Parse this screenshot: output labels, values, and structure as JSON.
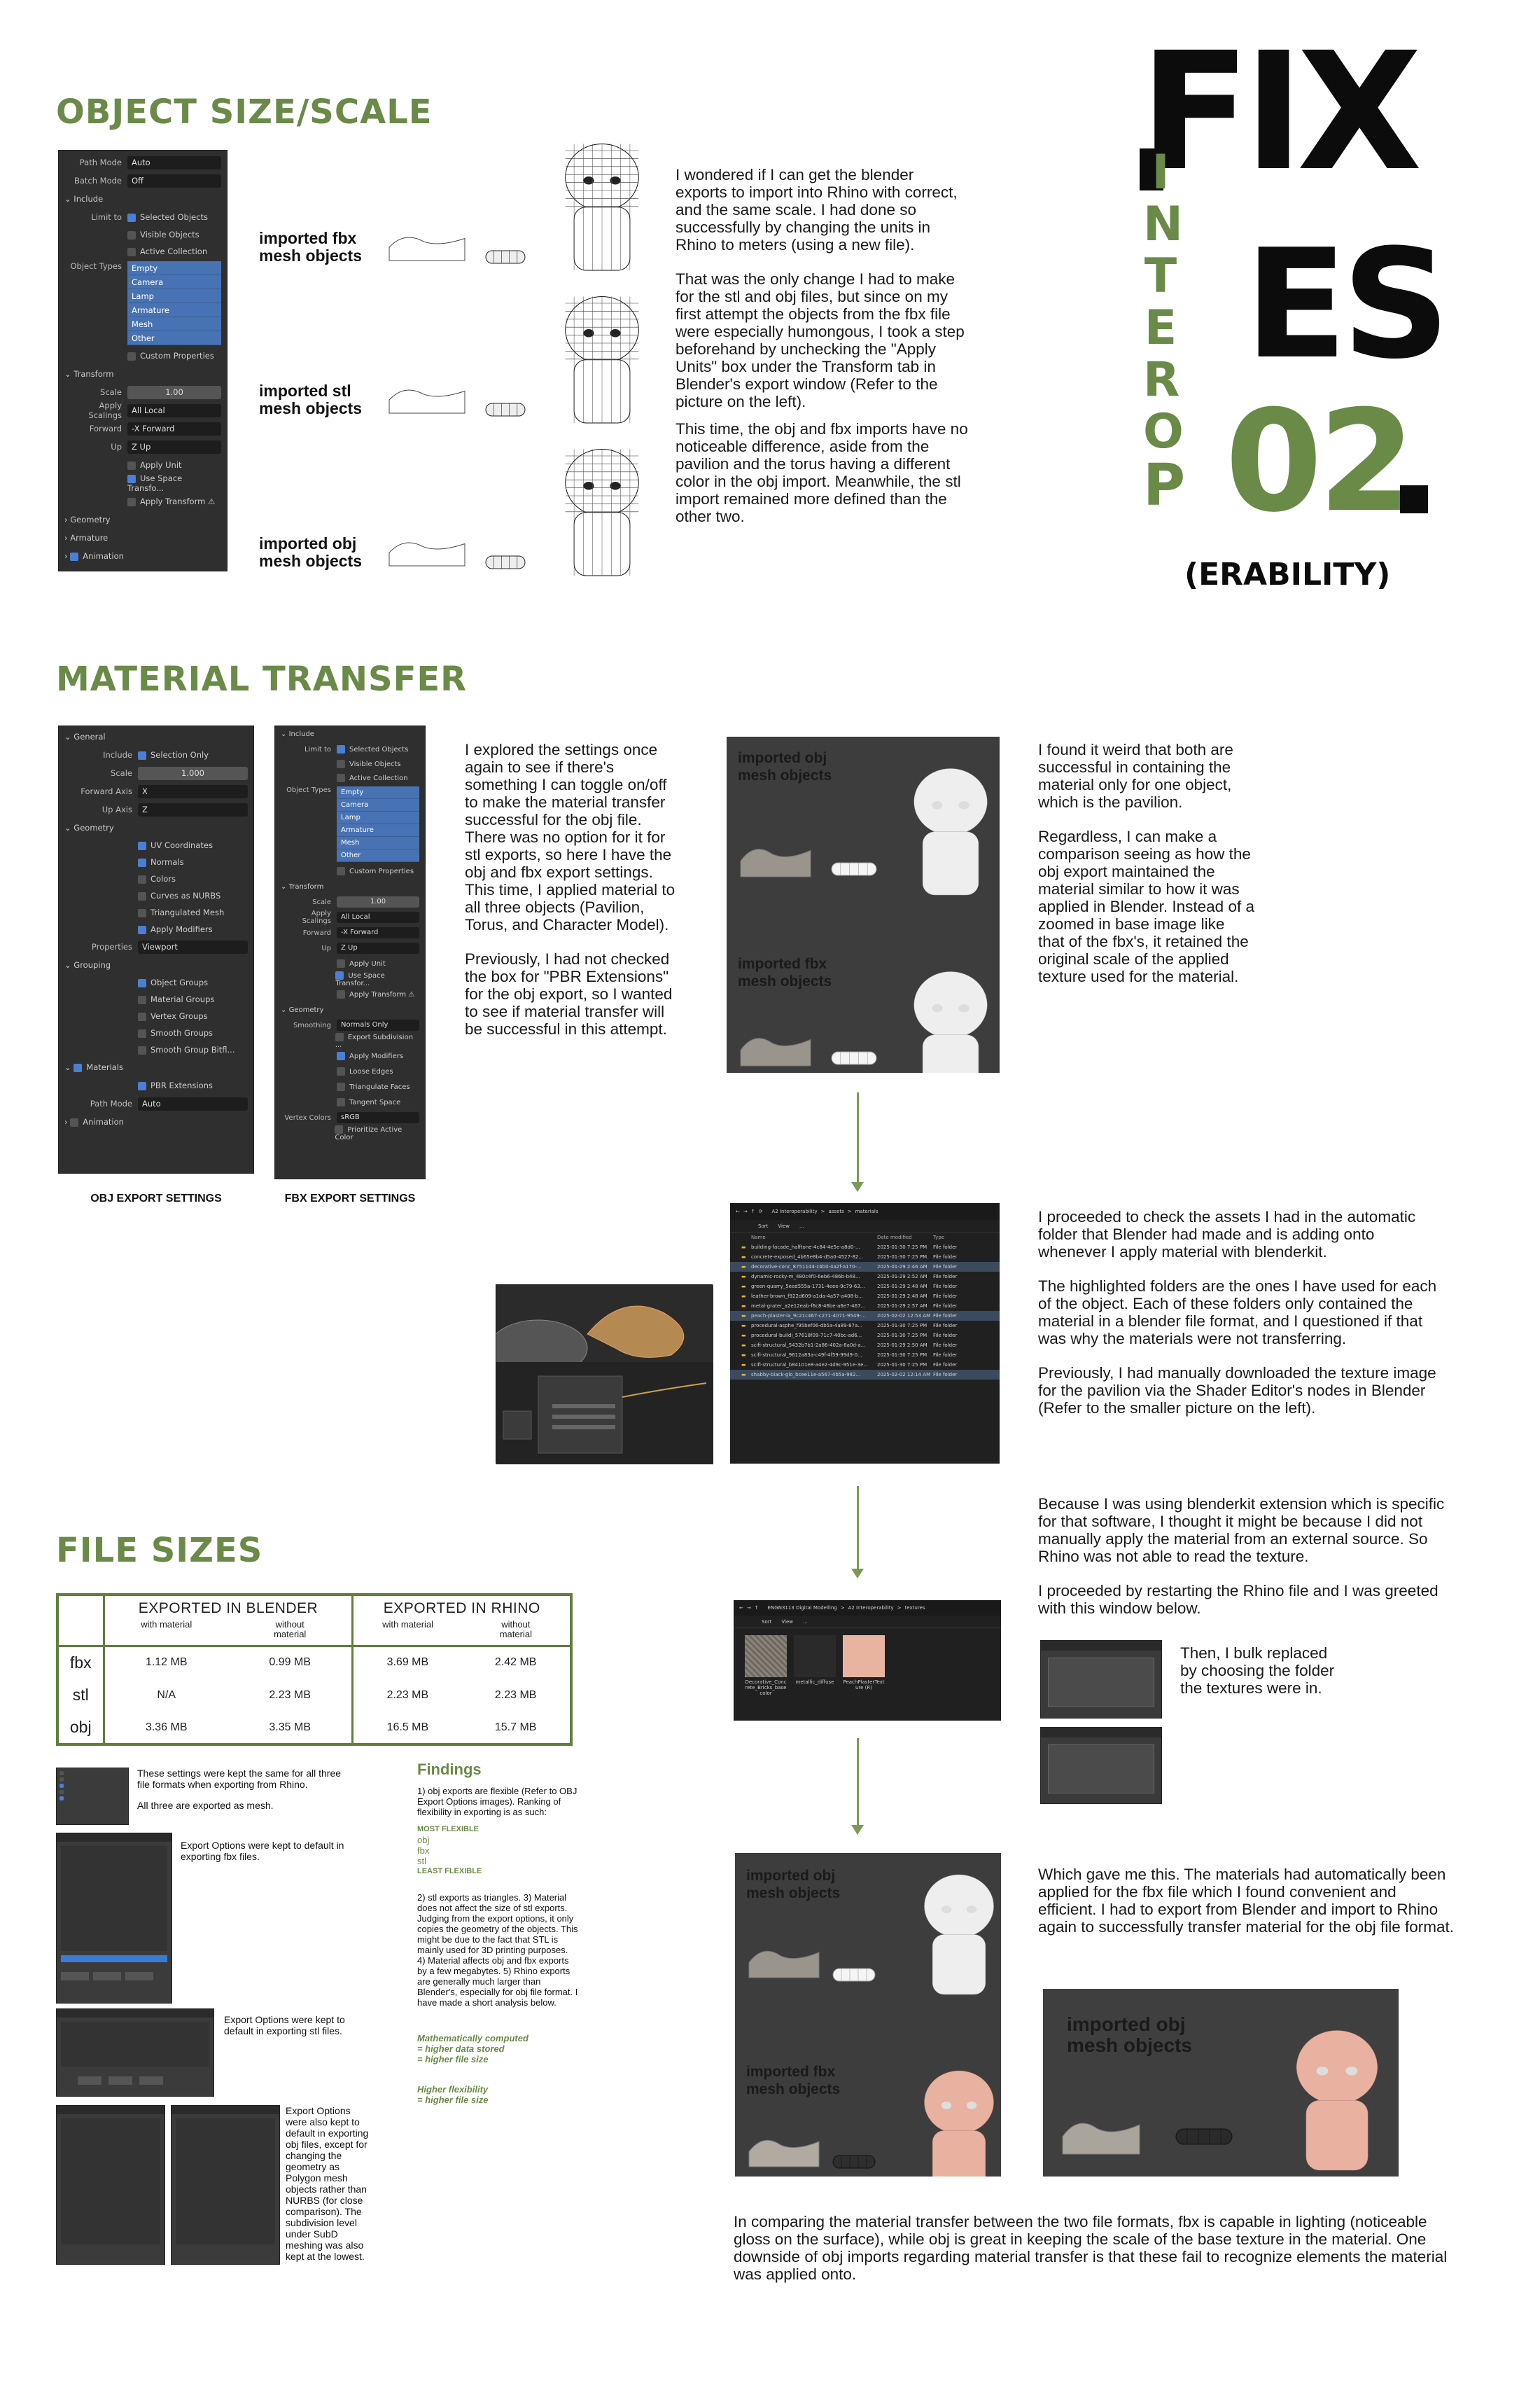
{
  "title": {
    "fix1": "FIX",
    "fix2": "ES",
    "num": "02",
    "dot": ".",
    "interop_letters": [
      "I",
      "N",
      "T",
      "E",
      "R",
      "O",
      "P"
    ],
    "erability": "(ERABILITY)"
  },
  "section1": {
    "heading": "OBJECT SIZE/SCALE",
    "panel": {
      "rows": [
        {
          "k": "Path Mode",
          "v": "Auto"
        },
        {
          "k": "Batch Mode",
          "v": "Off"
        }
      ],
      "include": "Include",
      "limit_to": "Limit to",
      "selected_objects": "Selected Objects",
      "visible_objects": "Visible Objects",
      "active_collection": "Active Collection",
      "object_types": "Object Types",
      "types": [
        "Empty",
        "Camera",
        "Lamp",
        "Armature",
        "Mesh",
        "Other"
      ],
      "custom_properties": "Custom Properties",
      "transform": "Transform",
      "scale_k": "Scale",
      "scale_v": "1.00",
      "apply_scalings_k": "Apply Scalings",
      "apply_scalings_v": "All Local",
      "forward_k": "Forward",
      "forward_v": "-X Forward",
      "up_k": "Up",
      "up_v": "Z Up",
      "apply_unit": "Apply Unit",
      "use_space": "Use Space Transfo...",
      "apply_transform": "Apply Transform",
      "geometry": "Geometry",
      "armature": "Armature",
      "animation": "Animation"
    },
    "labels": [
      "imported fbx mesh objects",
      "imported stl mesh objects",
      "imported obj mesh objects"
    ],
    "text": [
      "I wondered if I can get the blender exports to import into Rhino with correct, and the same scale. I had done so successfully by changing the units in Rhino to meters (using a new file).",
      "That was the only change I had to make for the stl and obj files, but since on my first attempt the objects from the fbx file were especially humongous, I took a step beforehand by unchecking the \"Apply Units\" box under the Transform tab in Blender's export window (Refer to the picture on the left).",
      "This time, the obj and fbx imports have no noticeable difference, aside from the pavilion and the torus having a different color in the obj import. Meanwhile, the stl import remained more defined than the other two."
    ]
  },
  "section2": {
    "heading": "MATERIAL TRANSFER",
    "obj_panel": {
      "general": "General",
      "include_k": "Include",
      "include_v": "Selection Only",
      "scale_k": "Scale",
      "scale_v": "1.000",
      "forward_k": "Forward Axis",
      "forward_v": "X",
      "up_k": "Up Axis",
      "up_v": "Z",
      "geometry": "Geometry",
      "geo_items": [
        "UV Coordinates",
        "Normals",
        "Colors",
        "Curves as NURBS",
        "Triangulated Mesh",
        "Apply Modifiers"
      ],
      "properties_k": "Properties",
      "properties_v": "Viewport",
      "grouping": "Grouping",
      "group_items": [
        "Object Groups",
        "Material Groups",
        "Vertex Groups",
        "Smooth Groups",
        "Smooth Group Bitfl..."
      ],
      "materials": "Materials",
      "pbr": "PBR Extensions",
      "path_k": "Path Mode",
      "path_v": "Auto",
      "animation": "Animation"
    },
    "fbx_panel": {
      "include": "Include",
      "limit_to": "Limit to",
      "selected_objects": "Selected Objects",
      "visible_objects": "Visible Objects",
      "active_collection": "Active Collection",
      "object_types": "Object Types",
      "types": [
        "Empty",
        "Camera",
        "Lamp",
        "Armature",
        "Mesh",
        "Other"
      ],
      "custom_properties": "Custom Properties",
      "transform": "Transform",
      "scale_k": "Scale",
      "scale_v": "1.00",
      "apply_scalings_k": "Apply Scalings",
      "apply_scalings_v": "All Local",
      "forward_k": "Forward",
      "forward_v": "-X Forward",
      "up_k": "Up",
      "up_v": "Z Up",
      "apply_unit": "Apply Unit",
      "use_space": "Use Space Transfor...",
      "apply_transform": "Apply Transform",
      "geometry": "Geometry",
      "smoothing_k": "Smoothing",
      "smoothing_v": "Normals Only",
      "geo_items": [
        "Export Subdivision ...",
        "Apply Modifiers",
        "Loose Edges",
        "Triangulate Faces",
        "Tangent Space"
      ],
      "vertex_k": "Vertex Colors",
      "vertex_v": "sRGB",
      "prioritize": "Prioritize Active Color"
    },
    "caption_obj": "OBJ EXPORT SETTINGS",
    "caption_fbx": "FBX EXPORT SETTINGS",
    "text1": [
      "I explored the settings once again to see if there's something I can toggle on/off to make the material transfer successful for the obj file. There was no option for it for stl exports, so here I have the obj and fbx export settings. This time, I applied material to all three objects (Pavilion, Torus, and Character Model).",
      "Previously, I had not checked the box for \"PBR Extensions\" for the obj export, so I wanted to see if material transfer will be successful in this attempt."
    ],
    "render_labels": [
      "imported obj mesh objects",
      "imported fbx mesh objects"
    ],
    "text2": [
      "I found it weird that both are successful in containing the material only for one object, which is the pavilion.",
      "Regardless, I can make a comparison seeing as how the obj export maintained the material similar to how it was applied in Blender. Instead of a zoomed in base image like that of the fbx's, it retained the original scale of the applied texture used for the material."
    ],
    "explorer": {
      "path": [
        "A2 Interoperability",
        ">",
        "assets",
        ">",
        "materials"
      ],
      "toolbar": [
        "Sort",
        "View",
        "..."
      ],
      "cols": [
        "Name",
        "Date modified",
        "Type"
      ],
      "rows": [
        {
          "n": "building-facade_halftone-4c84-4e5e-a8d0-...",
          "d": "2025-01-30 7:25 PM",
          "t": "File folder",
          "hl": false
        },
        {
          "n": "concrete-exposed_4b65e8b4-d5a0-4527-82...",
          "d": "2025-01-30 7:25 PM",
          "t": "File folder",
          "hl": false
        },
        {
          "n": "decorative-conc_8751144-c4b0-4a2f-a170-...",
          "d": "2025-01-29 2:46 AM",
          "t": "File folder",
          "hl": true
        },
        {
          "n": "dynamic-rocky-m_480c4f0-6eb6-486b-b48...",
          "d": "2025-01-29 2:52 AM",
          "t": "File folder",
          "hl": false
        },
        {
          "n": "green-quarry_5eed555a-1731-4eee-9c79-63...",
          "d": "2025-01-29 2:48 AM",
          "t": "File folder",
          "hl": false
        },
        {
          "n": "leather-brown_f922d609-a1da-4a57-a408-b...",
          "d": "2025-01-29 2:48 AM",
          "t": "File folder",
          "hl": false
        },
        {
          "n": "metal-grater_a2e12eab-f6c8-46be-a6e7-467...",
          "d": "2025-01-29 2:57 AM",
          "t": "File folder",
          "hl": false
        },
        {
          "n": "peach-plaster-la_9c21c467-c271-4071-9549-...",
          "d": "2025-02-02 12:53 AM",
          "t": "File folder",
          "hl": true
        },
        {
          "n": "procedural-asphe_f95bef06-db5a-4a89-87a...",
          "d": "2025-01-30 7:25 PM",
          "t": "File folder",
          "hl": false
        },
        {
          "n": "procedural-buildi_57618f09-71c7-40bc-ad6...",
          "d": "2025-01-30 7:25 PM",
          "t": "File folder",
          "hl": false
        },
        {
          "n": "scifi-structural_5432b7b1-2a86-402a-8a0d-a...",
          "d": "2025-01-29 2:50 AM",
          "t": "File folder",
          "hl": false
        },
        {
          "n": "scifi-structural_9612a83a-c49f-4f59-99d9-0...",
          "d": "2025-01-30 7:25 PM",
          "t": "File folder",
          "hl": false
        },
        {
          "n": "scifi-structural_b84101e8-a4e2-4d9c-951e-3e...",
          "d": "2025-01-30 7:25 PM",
          "t": "File folder",
          "hl": false
        },
        {
          "n": "shabby-black-glo_bcee11e-a567-4b5a-982...",
          "d": "2025-02-02 12:14 AM",
          "t": "File folder",
          "hl": true
        }
      ]
    },
    "text3": [
      "I proceeded to check the assets I had in the automatic folder that Blender had made and is adding onto whenever I apply material with blenderkit.",
      "The highlighted folders are the ones I have used for each of the object. Each of these folders only contained the material in a blender file format, and I questioned if that was why the materials were not transferring.",
      "Previously, I had manually downloaded the texture image for the pavilion via the Shader Editor's nodes in Blender (Refer to the smaller picture on the left)."
    ],
    "text4": [
      "Because I was using blenderkit extension which is specific for that software, I thought it might be because I did not manually apply the material from an external source. So Rhino was not able to read the texture.",
      "I proceeded by restarting the Rhino file and I was greeted with this window below."
    ],
    "textures_explorer": {
      "path": [
        "ENGN3113 Digital Modelling",
        ">",
        "A2 Interoperability",
        ">",
        "textures"
      ],
      "toolbar": [
        "Sort",
        "View",
        "..."
      ],
      "files": [
        "Decorative_Conc rete_Bricks_base color",
        "metallic_diffuse",
        "PeachPlasterText ure (R)"
      ]
    },
    "text5": "Then, I bulk replaced by choosing the folder the textures were in.",
    "text6": "Which gave me this. The materials had automatically been applied for the fbx file which I found convenient and efficient. I had to export from Blender and import to Rhino again to successfully transfer material for the obj file format.",
    "render2_labels": [
      "imported obj mesh objects",
      "imported fbx mesh objects"
    ],
    "render3_label": "imported obj mesh objects",
    "text7": "In comparing the material transfer between the two file formats, fbx is capable in lighting (noticeable gloss on the surface), while obj is great in keeping the scale of the base texture in the material. One downside of obj imports regarding material transfer is that these fail to recognize elements the material was applied onto."
  },
  "section3": {
    "heading": "FILE SIZES",
    "table": {
      "col_groups": [
        "EXPORTED IN BLENDER",
        "EXPORTED IN RHINO"
      ],
      "sub": [
        "with material",
        "without material",
        "with material",
        "without material"
      ],
      "rows": [
        {
          "fmt": "fbx",
          "v": [
            "1.12 MB",
            "0.99 MB",
            "3.69 MB",
            "2.42 MB"
          ]
        },
        {
          "fmt": "stl",
          "v": [
            "N/A",
            "2.23 MB",
            "2.23 MB",
            "2.23 MB"
          ]
        },
        {
          "fmt": "obj",
          "v": [
            "3.36 MB",
            "3.35 MB",
            "16.5 MB",
            "15.7 MB"
          ]
        }
      ]
    },
    "note1": "These settings were kept the same for all three file formats when exporting from Rhino.",
    "note1b": "All three are exported as mesh.",
    "note2": "Export Options were kept to default in exporting fbx files.",
    "note3": "Export Options were kept to default in exporting stl files.",
    "note4": "Export Options were also kept to default in exporting obj files, except for changing the geometry as Polygon mesh objects rather than NURBS (for close comparison). The subdivision level under SubD meshing was also kept at the lowest.",
    "findings_title": "Findings",
    "findings": [
      "1) obj exports are flexible (Refer to OBJ Export Options images). Ranking of flexibility in exporting is as such:"
    ],
    "rank_most": "MOST FLEXIBLE",
    "rank_items": [
      "obj",
      "fbx",
      "stl"
    ],
    "rank_least": "LEAST FLEXIBLE",
    "findings2": "2) stl exports as triangles. 3) Material does not affect the size of stl exports. Judging from the export options, it only copies the geometry of the objects. This might be due to the fact that STL is mainly used for 3D printing purposes. 4) Material affects obj and fbx exports by a few megabytes. 5) Rhino exports are generally much larger than Blender's, especially for obj file format. I have made a short analysis below.",
    "green1a": "Mathematically computed",
    "green1b": "= higher data stored",
    "green1c": "= higher file size",
    "green2a": "Higher flexibility",
    "green2b": "= higher file size"
  },
  "colors": {
    "green": "#6a8a47",
    "black": "#0c0c0c"
  }
}
